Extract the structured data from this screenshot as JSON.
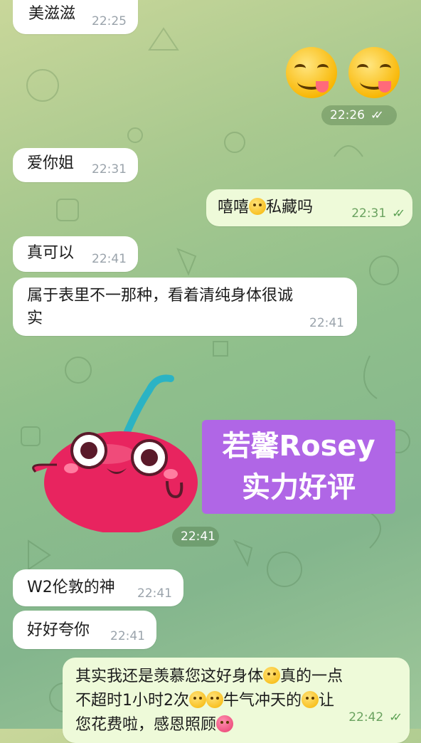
{
  "messages": {
    "m1": {
      "text": "美滋滋",
      "time": "22:25"
    },
    "m2_time": "22:26",
    "m3": {
      "text": "爱你姐",
      "time": "22:31"
    },
    "m4": {
      "text_a": "嘻嘻",
      "text_b": "私藏吗",
      "time": "22:31"
    },
    "m5": {
      "text": "真可以",
      "time": "22:41"
    },
    "m6": {
      "line1": "属于表里不一那种，看着清纯身体很诚",
      "line2": "实",
      "time": "22:41"
    },
    "sticker": {
      "line1": "若馨Rosey",
      "line2": "实力好评",
      "time": "22:41"
    },
    "m7": {
      "text": "W2伦敦的神",
      "time": "22:41"
    },
    "m8": {
      "text": "好好夸你",
      "time": "22:41"
    },
    "m9": {
      "line1a": "其实我还是羡慕您这好身体",
      "line1b": "真的一点",
      "line2a": "不超时1小时2次",
      "line2b": "牛气冲天的",
      "line2c": "让",
      "line3a": "您花费啦，感恩照顾",
      "time": "22:42"
    }
  },
  "icons": {
    "read_ticks": "double-check-icon",
    "emoji": "yum-emoji-icon",
    "sticker": "cherry-sticker"
  }
}
